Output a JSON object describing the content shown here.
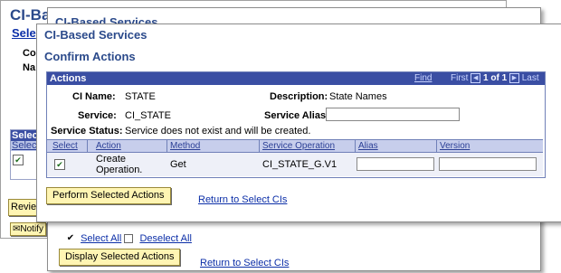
{
  "win1": {
    "title": "CI-Ba",
    "subtitle": "Sele",
    "label_co": "Co",
    "label_na": "Na",
    "grid_header": "Selec",
    "grid_col": "Selec",
    "grid_checked": "✔",
    "review_button": "Revie",
    "notify_button": "Notify"
  },
  "win2": {
    "title": "CI-Based Services",
    "select_all_checked": "✔",
    "select_all": "Select All",
    "deselect_all": "Deselect All",
    "display_button": "Display Selected Actions",
    "return_link": "Return to Select CIs"
  },
  "win3": {
    "title": "CI-Based Services",
    "confirm_heading": "Confirm Actions",
    "actions": {
      "label": "Actions",
      "find": "Find",
      "nav_first": "First",
      "nav_position": "1 of 1",
      "nav_last": "Last",
      "ci_name_label": "CI Name:",
      "ci_name_value": "STATE",
      "description_label": "Description:",
      "description_value": "State Names",
      "service_label": "Service:",
      "service_value": "CI_STATE",
      "service_alias_label": "Service Alias:",
      "service_alias_value": "",
      "service_status_label": "Service Status:",
      "service_status_value": "Service does not exist and will be created.",
      "columns": [
        "Select",
        "Action",
        "Method",
        "Service Operation",
        "Alias",
        "Version"
      ],
      "row": {
        "checked": "✔",
        "action_line1": "Create",
        "action_line2": "Operation.",
        "method": "Get",
        "service_operation": "CI_STATE_G.V1",
        "alias": "",
        "version": ""
      }
    },
    "perform_button": "Perform Selected Actions",
    "return_link": "Return to Select CIs"
  }
}
